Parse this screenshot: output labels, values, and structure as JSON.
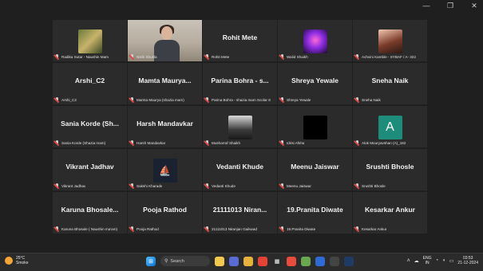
{
  "window_controls": [
    "—",
    "❐",
    "✕"
  ],
  "tiles": [
    {
      "id": "t1",
      "name": "Radika Sutar - Naushin Mam",
      "avatar": "img1"
    },
    {
      "id": "t2",
      "name": "Nishi Shukla",
      "video": true
    },
    {
      "id": "t3",
      "big": "Rohit Mete",
      "name": "Rohit Mete"
    },
    {
      "id": "t4",
      "name": "Walid Shaikh",
      "avatar": "img2"
    },
    {
      "id": "t5",
      "name": "Achvini Kamble - SYBAF / A- 322",
      "avatar": "img3"
    },
    {
      "id": "t6",
      "big": "Arshi_C2",
      "name": "Arshi_C2"
    },
    {
      "id": "t7",
      "big": "Mamta Maurya...",
      "name": "Mamta Maurya (shazia mam)"
    },
    {
      "id": "t8",
      "big": "Parina Bohra - s...",
      "name": "Parina Bohra - shazia mam Scolar 8"
    },
    {
      "id": "t9",
      "big": "Shreya Yewale",
      "name": "Shreya Yewale"
    },
    {
      "id": "t10",
      "big": "Sneha Naik",
      "name": "Sneha Naik"
    },
    {
      "id": "t11",
      "big": "Sania Korde (Sh...",
      "name": "Sania Korde (Shazia mam)"
    },
    {
      "id": "t12",
      "big": "Harsh Mandavkar",
      "name": "Harsh Mandavkar"
    },
    {
      "id": "t13",
      "name": "Musharraf Shaikh",
      "avatar": "img4"
    },
    {
      "id": "t14",
      "name": "Idrisi Afsha",
      "avatar": "black"
    },
    {
      "id": "t15",
      "name": "Alok Mouryavshan (A)_182",
      "avatar": "letter",
      "letter": "A"
    },
    {
      "id": "t16",
      "big": "Vikrant Jadhav",
      "name": "Vikrant Jadhav"
    },
    {
      "id": "t17",
      "name": "Sakshi Kharade",
      "avatar": "logo"
    },
    {
      "id": "t18",
      "big": "Vedanti Khude",
      "name": "Vedanti Khude"
    },
    {
      "id": "t19",
      "big": "Meenu Jaiswar",
      "name": "Meenu Jaiswar"
    },
    {
      "id": "t20",
      "big": "Srushti Bhosle",
      "name": "Srushti Bhosle"
    },
    {
      "id": "t21",
      "big": "Karuna Bhosale...",
      "name": "Karuna Bhosale ( Naushin ma'am)"
    },
    {
      "id": "t22",
      "big": "Pooja Rathod",
      "name": "Pooja Rathod"
    },
    {
      "id": "t23",
      "big": "21111013 Niran...",
      "name": "21111013 Niranjan Gaikwad"
    },
    {
      "id": "t24",
      "big": "19.Pranita Diwate",
      "name": "19.Pranita Diwate"
    },
    {
      "id": "t25",
      "big": "Kesarkar Ankur",
      "name": "Kesarkar Ankur"
    }
  ],
  "taskbar": {
    "weather_temp": "25°C",
    "weather_desc": "Smoke",
    "search_label": "Search",
    "lang_line1": "ENG",
    "lang_line2": "IN",
    "time": "03:53",
    "date": "21-12-2024"
  },
  "colors": {
    "active_border": "#4bd6a0",
    "tile_bg": "#2b2b2b",
    "muted_mic": "#e04848"
  }
}
